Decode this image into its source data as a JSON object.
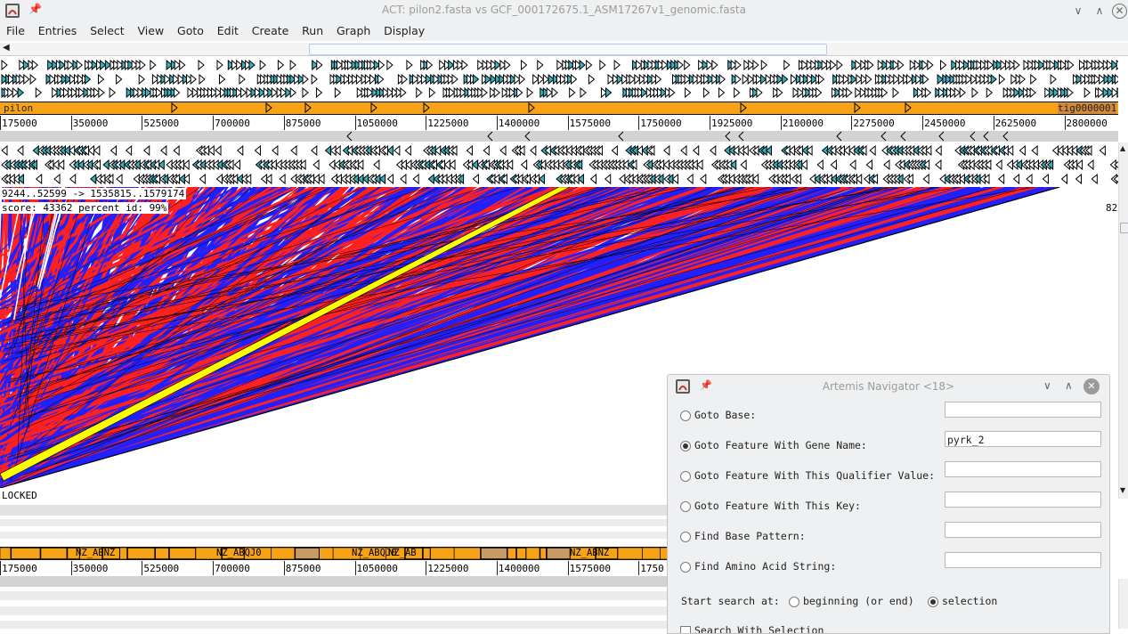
{
  "window": {
    "title": "ACT: pilon2.fasta vs GCF_000172675.1_ASM17267v1_genomic.fasta",
    "controls": [
      "∨",
      "∧",
      "✕"
    ]
  },
  "menu": [
    "File",
    "Entries",
    "Select",
    "View",
    "Goto",
    "Edit",
    "Create",
    "Run",
    "Graph",
    "Display"
  ],
  "top_contig": {
    "left_label": "pilon",
    "right_label": "tig0000001"
  },
  "ruler_labels": [
    "175000",
    "350000",
    "525000",
    "700000",
    "875000",
    "1050000",
    "1225000",
    "1400000",
    "1575000",
    "1750000",
    "1925000",
    "2100000",
    "2275000",
    "2450000",
    "2625000",
    "2800000"
  ],
  "bottom_ruler_labels": [
    "175000",
    "350000",
    "525000",
    "700000",
    "875000",
    "1050000",
    "1225000",
    "1400000",
    "1575000",
    "1750"
  ],
  "alignment_info": {
    "range": "9244..52599 -> 1535815..1579174",
    "score": "score: 43362  percent id: 99%",
    "right_number": "82",
    "locked": "LOCKED"
  },
  "bottom_feature_labels": [
    "NZ_ABNZ",
    "NZ_ABQJ0",
    "NZ_ABQJ0",
    "NZ_AB",
    "NZ_ABNZ"
  ],
  "navigator": {
    "title": "Artemis Navigator <18>",
    "options": [
      {
        "label": "Goto Base:",
        "value": "",
        "selected": false
      },
      {
        "label": "Goto Feature With Gene Name:",
        "value": "pyrk_2",
        "selected": true
      },
      {
        "label": "Goto Feature With This Qualifier Value:",
        "value": "",
        "selected": false
      },
      {
        "label": "Goto Feature With This Key:",
        "value": "",
        "selected": false
      },
      {
        "label": "Find Base Pattern:",
        "value": "",
        "selected": false
      },
      {
        "label": "Find Amino Acid String:",
        "value": "",
        "selected": false
      }
    ],
    "start_search_label": "Start search at:",
    "start_options": [
      {
        "label": "beginning (or end)",
        "selected": false
      },
      {
        "label": "selection",
        "selected": true
      }
    ],
    "partial_text": "Search With Selection"
  },
  "colors": {
    "contig": "#f7a317",
    "forward_match": "#ff2020",
    "reverse_match": "#2020ff",
    "highlight": "#ffff00"
  }
}
